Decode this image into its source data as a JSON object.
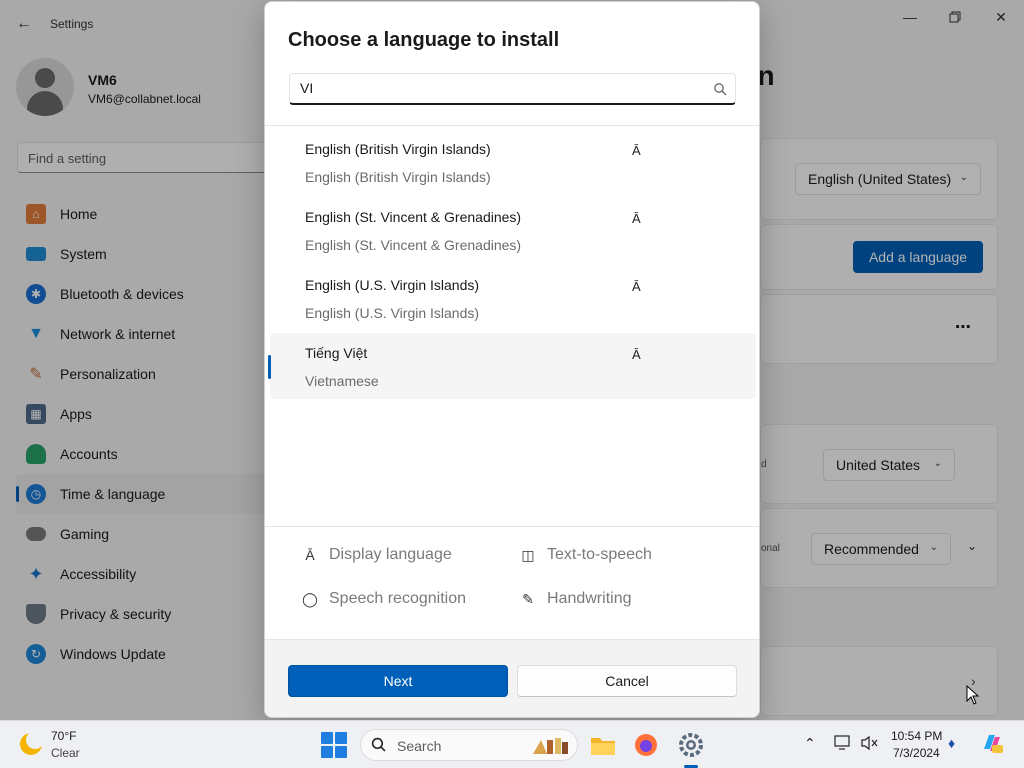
{
  "window": {
    "title": "Settings",
    "back_icon": "arrow-left-icon",
    "minimize_icon": "minimize-icon",
    "maximize_icon": "restore-icon",
    "close_icon": "close-icon"
  },
  "profile": {
    "name": "VM6",
    "email": "VM6@collabnet.local"
  },
  "search": {
    "placeholder": "Find a setting"
  },
  "sidebar": {
    "items": [
      {
        "label": "Home",
        "icon": "home-icon",
        "color": "#e07b39"
      },
      {
        "label": "System",
        "icon": "system-icon",
        "color": "#1f8fd6"
      },
      {
        "label": "Bluetooth & devices",
        "icon": "bluetooth-icon",
        "color": "#1b6ed2"
      },
      {
        "label": "Network & internet",
        "icon": "wifi-icon",
        "color": "#1b8ee0"
      },
      {
        "label": "Personalization",
        "icon": "brush-icon",
        "color": "#c56b38"
      },
      {
        "label": "Apps",
        "icon": "apps-icon",
        "color": "#4d6a8a"
      },
      {
        "label": "Accounts",
        "icon": "accounts-icon",
        "color": "#2aa36b"
      },
      {
        "label": "Time & language",
        "icon": "clock-globe-icon",
        "color": "#1d7cd6",
        "active": true
      },
      {
        "label": "Gaming",
        "icon": "gamepad-icon",
        "color": "#7a7a7a"
      },
      {
        "label": "Accessibility",
        "icon": "accessibility-icon",
        "color": "#1a73c9"
      },
      {
        "label": "Privacy & security",
        "icon": "shield-icon",
        "color": "#6d7a86"
      },
      {
        "label": "Windows Update",
        "icon": "update-icon",
        "color": "#1f86d6"
      }
    ]
  },
  "background_page": {
    "heading_fragment": "egion",
    "language_dropdown": "English (United States)",
    "add_language_button": "Add a language",
    "more_icon": "more-icon",
    "partial_label_1": "d",
    "region_dropdown": "United States",
    "partial_label_2": "onal",
    "format_dropdown": "Recommended"
  },
  "dialog": {
    "title": "Choose a language to install",
    "search_value": "VI",
    "search_icon": "search-icon",
    "languages": [
      {
        "native": "English (British Virgin Islands)",
        "english": "English (British Virgin Islands)",
        "feature_icon": "display-language-icon",
        "selected": false
      },
      {
        "native": "English (St. Vincent & Grenadines)",
        "english": "English (St. Vincent & Grenadines)",
        "feature_icon": "display-language-icon",
        "selected": false
      },
      {
        "native": "English (U.S. Virgin Islands)",
        "english": "English (U.S. Virgin Islands)",
        "feature_icon": "display-language-icon",
        "selected": false
      },
      {
        "native": "Tiếng Việt",
        "english": "Vietnamese",
        "feature_icon": "display-language-icon",
        "selected": true
      }
    ],
    "features": {
      "display_language": "Display language",
      "text_to_speech": "Text-to-speech",
      "speech_recognition": "Speech recognition",
      "handwriting": "Handwriting"
    },
    "next_button": "Next",
    "cancel_button": "Cancel"
  },
  "taskbar": {
    "weather_temp": "70°F",
    "weather_condition": "Clear",
    "search_label": "Search",
    "clock_time": "10:54 PM",
    "clock_date": "7/3/2024"
  },
  "colors": {
    "accent": "#005fb8",
    "start": "#1f7fe0"
  }
}
